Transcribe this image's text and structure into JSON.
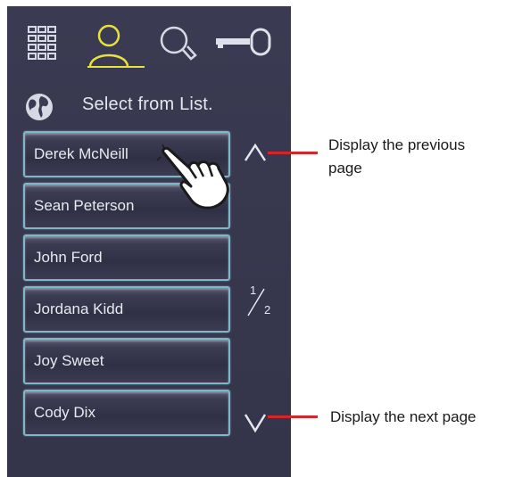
{
  "toolbar": {
    "keypad_icon": "keypad-icon",
    "person_icon": "person-icon",
    "search_icon": "search-icon",
    "key_icon": "key-icon",
    "active_color": "#e8e23a"
  },
  "header": {
    "globe_icon": "globe-icon",
    "label": "Select from List."
  },
  "names": [
    "Derek McNeill",
    "Sean Peterson",
    "John Ford",
    "Jordana Kidd",
    "Joy Sweet",
    "Cody Dix"
  ],
  "pagination": {
    "current": "1",
    "total": "2"
  },
  "callouts": {
    "prev_line1": "Display the previous",
    "prev_line2": "page",
    "next": "Display the next page",
    "line_color": "#d6242b"
  }
}
